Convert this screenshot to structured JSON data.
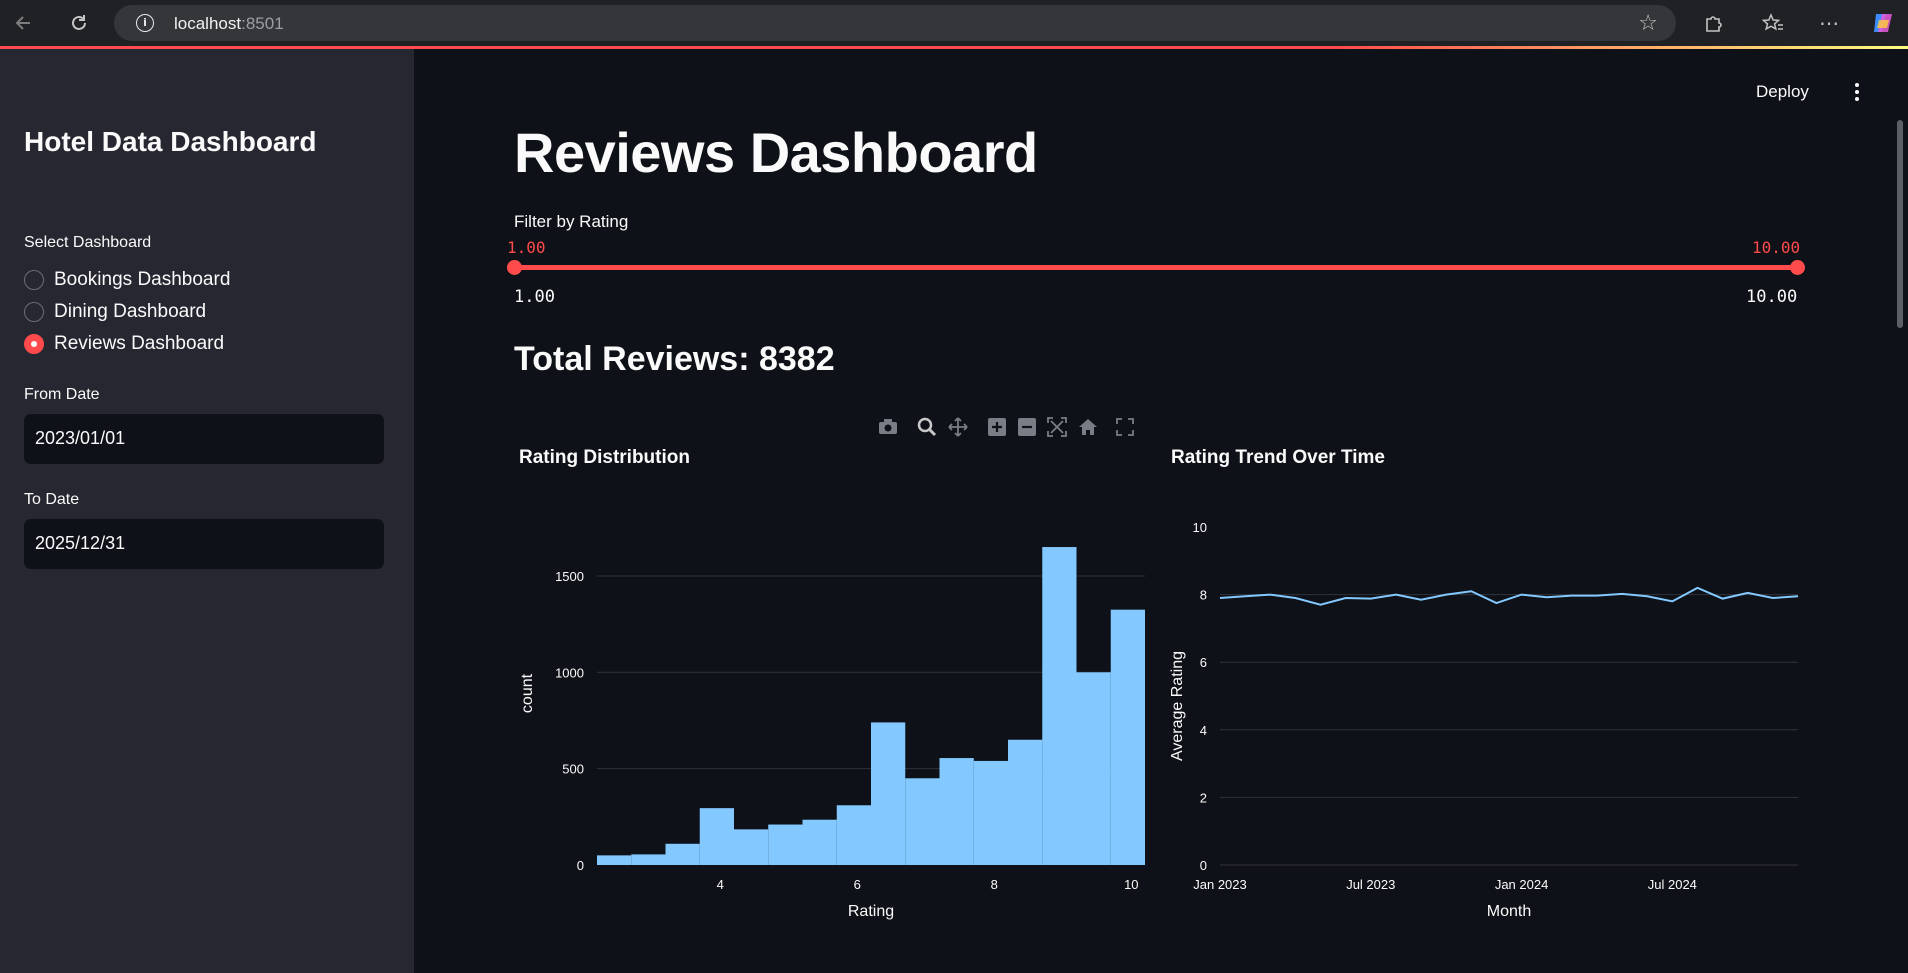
{
  "browser": {
    "url_host": "localhost",
    "url_port": ":8501"
  },
  "sidebar": {
    "title": "Hotel Data Dashboard",
    "select_label": "Select Dashboard",
    "options": [
      {
        "label": "Bookings Dashboard",
        "selected": false
      },
      {
        "label": "Dining Dashboard",
        "selected": false
      },
      {
        "label": "Reviews Dashboard",
        "selected": true
      }
    ],
    "from_label": "From Date",
    "from_value": "2023/01/01",
    "to_label": "To Date",
    "to_value": "2025/12/31"
  },
  "header": {
    "deploy_label": "Deploy"
  },
  "main": {
    "title": "Reviews Dashboard",
    "filter_label": "Filter by Rating",
    "slider": {
      "min_value": "1.00",
      "max_value": "10.00",
      "min_tick": "1.00",
      "max_tick": "10.00"
    },
    "total_reviews": "Total Reviews: 8382"
  },
  "colors": {
    "accent": "#ff4b4b",
    "bar": "#83c9ff",
    "line": "#83c9ff",
    "background": "#0e1117",
    "sidebar": "#262730"
  },
  "modebar_icons": [
    "camera-icon",
    "zoom-icon",
    "pan-icon",
    "zoom-in-icon",
    "zoom-out-icon",
    "autoscale-icon",
    "reset-axes-icon",
    "fullscreen-icon"
  ],
  "chart_data": [
    {
      "type": "bar",
      "title": "Rating Distribution",
      "xlabel": "Rating",
      "ylabel": "count",
      "x_ticks": [
        "4",
        "6",
        "8",
        "10"
      ],
      "y_ticks": [
        "0",
        "500",
        "1000",
        "1500"
      ],
      "xlim": [
        2.2,
        10.2
      ],
      "ylim": [
        0,
        1780
      ],
      "bins": [
        {
          "x0": 2.2,
          "x1": 2.7,
          "value": 50
        },
        {
          "x0": 2.7,
          "x1": 3.2,
          "value": 55
        },
        {
          "x0": 3.2,
          "x1": 3.7,
          "value": 110
        },
        {
          "x0": 3.7,
          "x1": 4.2,
          "value": 295
        },
        {
          "x0": 4.2,
          "x1": 4.7,
          "value": 185
        },
        {
          "x0": 4.7,
          "x1": 5.2,
          "value": 210
        },
        {
          "x0": 5.2,
          "x1": 5.7,
          "value": 235
        },
        {
          "x0": 5.7,
          "x1": 6.2,
          "value": 310
        },
        {
          "x0": 6.2,
          "x1": 6.7,
          "value": 740
        },
        {
          "x0": 6.7,
          "x1": 7.2,
          "value": 450
        },
        {
          "x0": 7.2,
          "x1": 7.7,
          "value": 555
        },
        {
          "x0": 7.7,
          "x1": 8.2,
          "value": 540
        },
        {
          "x0": 8.2,
          "x1": 8.7,
          "value": 650
        },
        {
          "x0": 8.7,
          "x1": 9.2,
          "value": 1650
        },
        {
          "x0": 9.2,
          "x1": 9.7,
          "value": 1000
        },
        {
          "x0": 9.7,
          "x1": 10.2,
          "value": 1325
        }
      ]
    },
    {
      "type": "line",
      "title": "Rating Trend Over Time",
      "xlabel": "Month",
      "ylabel": "Average Rating",
      "x_ticks": [
        "Jan 2023",
        "Jul 2023",
        "Jan 2024",
        "Jul 2024"
      ],
      "y_ticks": [
        "0",
        "2",
        "4",
        "6",
        "8",
        "10"
      ],
      "ylim": [
        0,
        10
      ],
      "x": [
        "2023-01",
        "2023-02",
        "2023-03",
        "2023-04",
        "2023-05",
        "2023-06",
        "2023-07",
        "2023-08",
        "2023-09",
        "2023-10",
        "2023-11",
        "2023-12",
        "2024-01",
        "2024-02",
        "2024-03",
        "2024-04",
        "2024-05",
        "2024-06",
        "2024-07",
        "2024-08",
        "2024-09",
        "2024-10",
        "2024-11",
        "2024-12"
      ],
      "values": [
        7.9,
        7.95,
        8.0,
        7.9,
        7.7,
        7.9,
        7.88,
        8.0,
        7.85,
        8.0,
        8.1,
        7.75,
        8.0,
        7.92,
        7.97,
        7.97,
        8.02,
        7.95,
        7.8,
        8.2,
        7.88,
        8.05,
        7.9,
        7.95
      ]
    }
  ]
}
